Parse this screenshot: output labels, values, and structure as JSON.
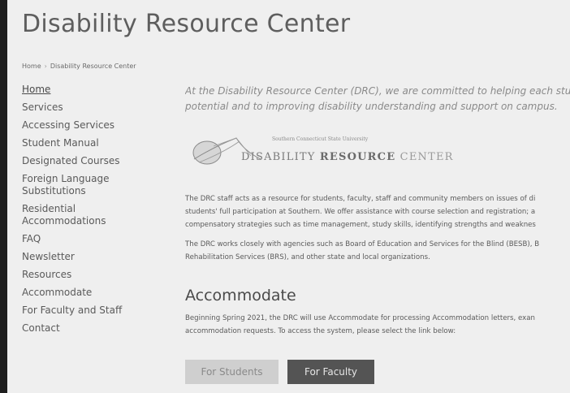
{
  "page": {
    "title": "Disability Resource Center"
  },
  "breadcrumb": {
    "home": "Home",
    "separator": "›",
    "current": "Disability Resource Center"
  },
  "sidebar": {
    "items": [
      {
        "label": "Home",
        "active": true
      },
      {
        "label": "Services"
      },
      {
        "label": "Accessing Services"
      },
      {
        "label": "Student Manual"
      },
      {
        "label": "Designated Courses"
      },
      {
        "label": "Foreign Language Substitutions"
      },
      {
        "label": "Residential Accommodations"
      },
      {
        "label": "FAQ"
      },
      {
        "label": "Newsletter"
      },
      {
        "label": "Resources"
      },
      {
        "label": "Accommodate"
      },
      {
        "label": "For Faculty and Staff"
      },
      {
        "label": "Contact"
      }
    ]
  },
  "intro": {
    "line1": "At the Disability Resource Center (DRC), we are committed to helping each student reach",
    "line2": "potential and to improving disability understanding and support on campus."
  },
  "logo": {
    "university": "Southern Connecticut State University",
    "word1": "DISABILITY",
    "word2": "RESOURCE",
    "word3": "CENTER"
  },
  "about": {
    "p1": [
      "The DRC staff acts as a resource for students, faculty, staff and community members on issues of di",
      "students' full participation at Southern. We offer assistance with course selection and registration; a",
      "compensatory strategies such as time management, study skills, identifying strengths and weaknes"
    ],
    "p2": [
      "The DRC works closely with agencies such as Board of Education and Services for the Blind (BESB), B",
      "Rehabilitation Services (BRS), and other state and local organizations."
    ]
  },
  "accommodate": {
    "heading": "Accommodate",
    "text": [
      "Beginning Spring 2021, the DRC will use Accommodate for processing Accommodation letters, exan",
      "accommodation requests.  To access the system, please select the link below:"
    ],
    "students_button": "For Students",
    "faculty_button": "For Faculty"
  },
  "colors": {
    "page_bg": "#efefef",
    "frame": "#1e1e1e",
    "button_light": "#cfcfcf",
    "button_dark": "#545454"
  }
}
